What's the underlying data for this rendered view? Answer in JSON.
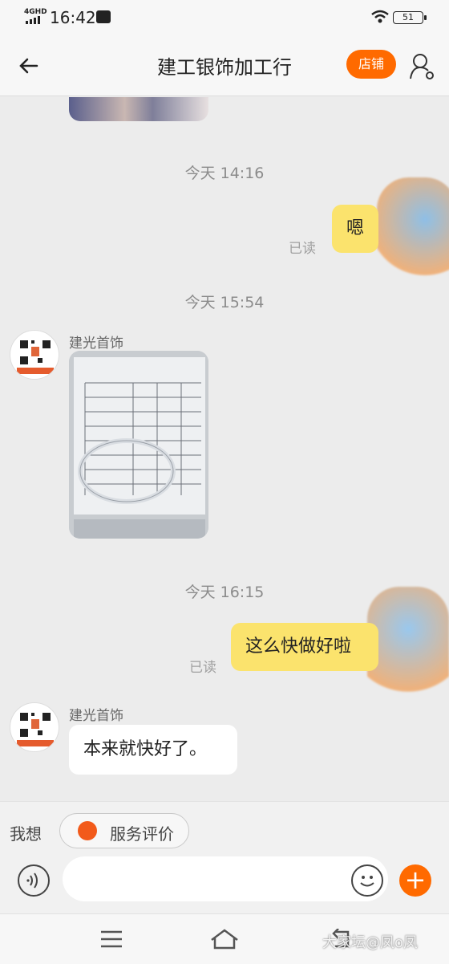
{
  "status_bar": {
    "network": "4GHD",
    "time": "16:42",
    "battery": "51",
    "icons": [
      "signal-icon",
      "app-icon",
      "wifi-icon",
      "battery-icon"
    ]
  },
  "header": {
    "title": "建工银饰加工行",
    "shop_button": "店铺",
    "icons": [
      "back-arrow-icon",
      "user-settings-icon"
    ]
  },
  "messages": [
    {
      "type": "time",
      "text": "今天  14:16"
    },
    {
      "type": "sent",
      "text": "嗯",
      "status": "已读"
    },
    {
      "type": "time",
      "text": "今天  15:54"
    },
    {
      "type": "received-image",
      "sender": "建光首饰"
    },
    {
      "type": "time",
      "text": "今天  16:15"
    },
    {
      "type": "sent",
      "text": "这么快做好啦",
      "status": "已读"
    },
    {
      "type": "received",
      "sender": "建光首饰",
      "text": "本来就快好了。"
    }
  ],
  "bottom": {
    "think_label": "我想",
    "eval_label": "服务评价",
    "input_placeholder": "",
    "icons": [
      "voice-icon",
      "emoji-icon",
      "plus-icon"
    ]
  },
  "nav": {
    "icons": [
      "menu-icon",
      "home-icon",
      "back-icon"
    ]
  },
  "watermark": "大家坛@凤o凤",
  "colors": {
    "accent": "#ff6a00",
    "sent_bubble": "#fbe36d",
    "background": "#ececec"
  }
}
